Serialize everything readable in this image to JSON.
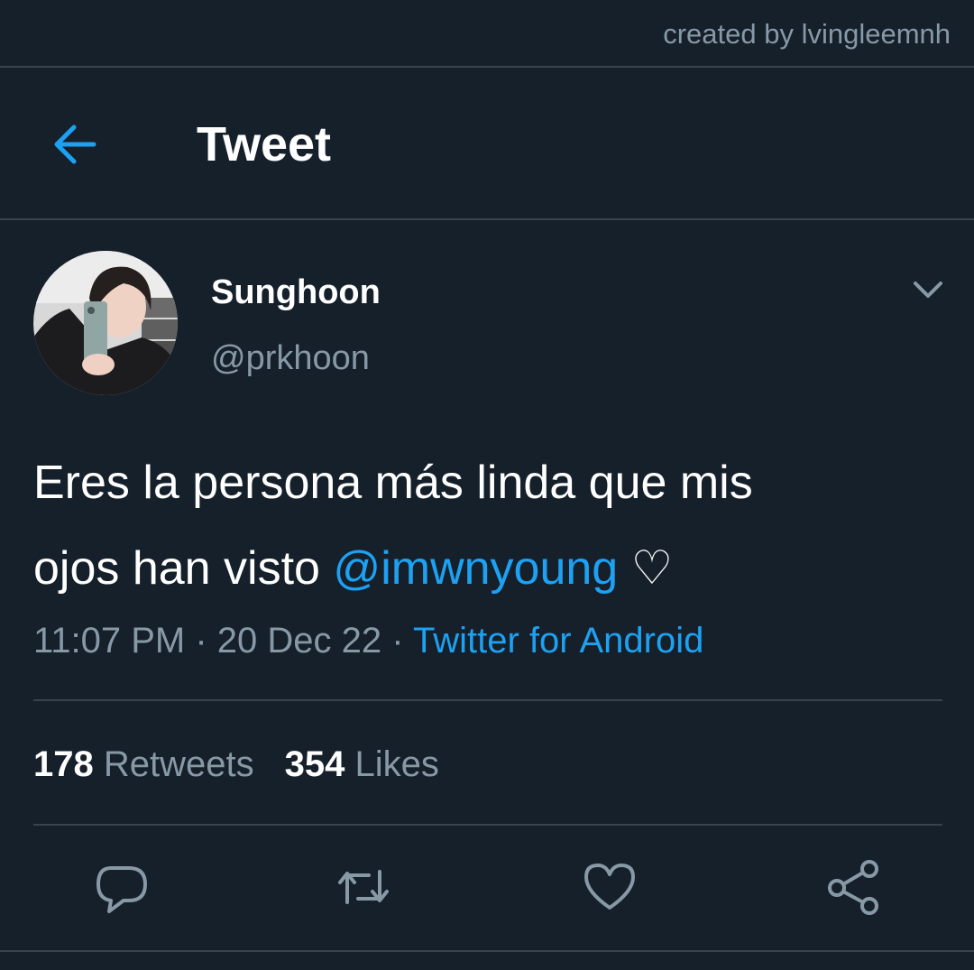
{
  "watermark": "created by lvingleemnh",
  "header": {
    "title": "Tweet",
    "back_icon": "arrow-left-icon"
  },
  "tweet": {
    "author": {
      "display_name": "Sunghoon",
      "handle": "@prkhoon"
    },
    "text_line1": "Eres la persona más linda que mis",
    "text_line2_before": "ojos han visto ",
    "mention": "@imwnyoung",
    "text_line2_after": " ♡",
    "time": "11:07 PM",
    "separator": " · ",
    "date": "20 Dec 22",
    "source": "Twitter for Android",
    "retweets_count": "178",
    "retweets_label": " Retweets",
    "likes_count": "354",
    "likes_label": " Likes"
  },
  "actions": [
    "reply-icon",
    "retweet-icon",
    "like-icon",
    "share-icon"
  ],
  "colors": {
    "background": "#15202b",
    "divider": "#38444d",
    "primary_text": "#ffffff",
    "secondary_text": "#8899a6",
    "accent": "#1da1f2"
  }
}
